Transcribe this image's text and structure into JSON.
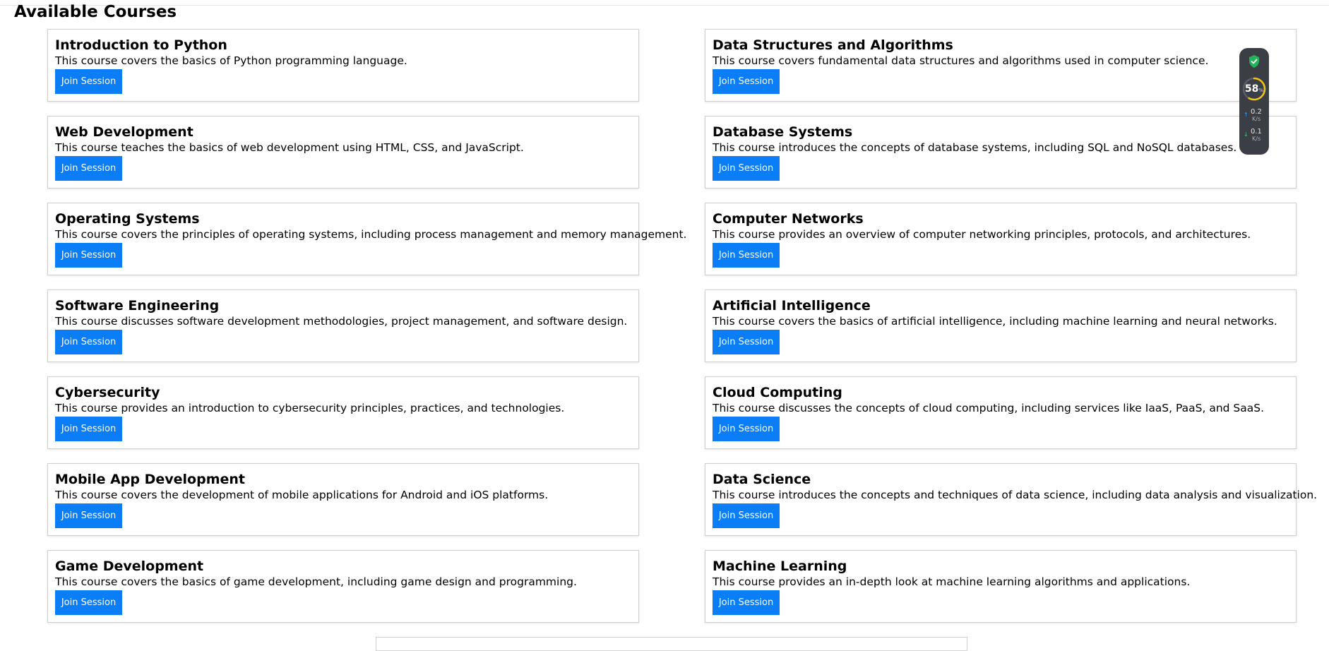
{
  "page": {
    "title": "Available Courses"
  },
  "courses": [
    {
      "title": "Introduction to Python",
      "description": "This course covers the basics of Python programming language.",
      "button": "Join Session"
    },
    {
      "title": "Data Structures and Algorithms",
      "description": "This course covers fundamental data structures and algorithms used in computer science.",
      "button": "Join Session"
    },
    {
      "title": "Web Development",
      "description": "This course teaches the basics of web development using HTML, CSS, and JavaScript.",
      "button": "Join Session"
    },
    {
      "title": "Database Systems",
      "description": "This course introduces the concepts of database systems, including SQL and NoSQL databases.",
      "button": "Join Session"
    },
    {
      "title": "Operating Systems",
      "description": "This course covers the principles of operating systems, including process management and memory management.",
      "button": "Join Session"
    },
    {
      "title": "Computer Networks",
      "description": "This course provides an overview of computer networking principles, protocols, and architectures.",
      "button": "Join Session"
    },
    {
      "title": "Software Engineering",
      "description": "This course discusses software development methodologies, project management, and software design.",
      "button": "Join Session"
    },
    {
      "title": "Artificial Intelligence",
      "description": "This course covers the basics of artificial intelligence, including machine learning and neural networks.",
      "button": "Join Session"
    },
    {
      "title": "Cybersecurity",
      "description": "This course provides an introduction to cybersecurity principles, practices, and technologies.",
      "button": "Join Session"
    },
    {
      "title": "Cloud Computing",
      "description": "This course discusses the concepts of cloud computing, including services like IaaS, PaaS, and SaaS.",
      "button": "Join Session"
    },
    {
      "title": "Mobile App Development",
      "description": "This course covers the development of mobile applications for Android and iOS platforms.",
      "button": "Join Session"
    },
    {
      "title": "Data Science",
      "description": "This course introduces the concepts and techniques of data science, including data analysis and visualization.",
      "button": "Join Session"
    },
    {
      "title": "Game Development",
      "description": "This course covers the basics of game development, including game design and programming.",
      "button": "Join Session"
    },
    {
      "title": "Machine Learning",
      "description": "This course provides an in-depth look at machine learning algorithms and applications.",
      "button": "Join Session"
    }
  ],
  "monitor": {
    "icon": "shield-check-icon",
    "usage_value": "58",
    "usage_unit": "%",
    "usage_fraction": 0.58,
    "upload_value": "0.2",
    "upload_unit": "K/s",
    "download_value": "0.1",
    "download_unit": "K/s"
  },
  "colors": {
    "button_bg": "#0a7df7",
    "monitor_bg": "#3b3e45",
    "shield": "#23b35a",
    "gauge_track": "#5a5e66",
    "gauge_fill": "#f0c419"
  }
}
